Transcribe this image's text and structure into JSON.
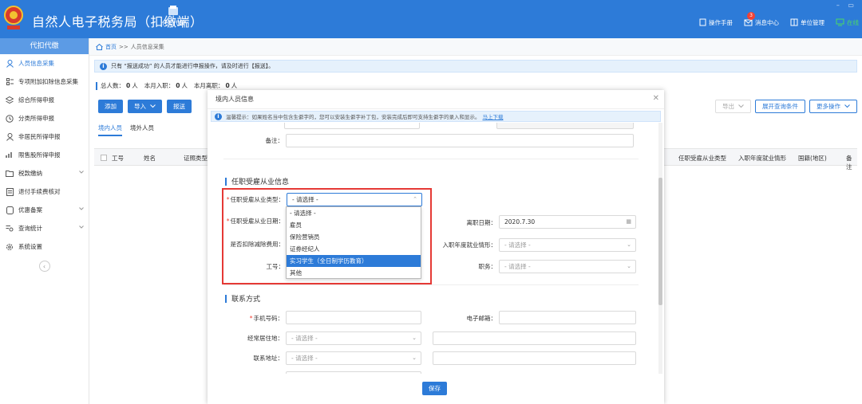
{
  "colors": {
    "primary": "#2d7bd8",
    "highlight": "#e53935",
    "required": "#f04134"
  },
  "header": {
    "app_title": "自然人电子税务局（扣缴端）",
    "withhold_label": "代扣代缴",
    "manual": "操作手册",
    "messages": "消息中心",
    "message_count": "3",
    "unit_mgmt": "单位管理",
    "online": "在线",
    "window_controls": "– ▭"
  },
  "sidebar": {
    "title": "代扣代缴",
    "items": [
      {
        "label": "人员信息采集",
        "icon": "person-icon"
      },
      {
        "label": "专项附加扣除信息采集",
        "icon": "list-icon"
      },
      {
        "label": "综合所得申报",
        "icon": "layers-icon"
      },
      {
        "label": "分类所得申报",
        "icon": "clock-icon"
      },
      {
        "label": "非居民所得申报",
        "icon": "person-icon"
      },
      {
        "label": "限售股所得申报",
        "icon": "bar-chart-icon"
      },
      {
        "label": "税款缴纳",
        "icon": "folder-icon"
      },
      {
        "label": "退付手续费核对",
        "icon": "document-icon"
      },
      {
        "label": "优惠备案",
        "icon": "tag-icon"
      },
      {
        "label": "查询统计",
        "icon": "search-list-icon"
      },
      {
        "label": "系统设置",
        "icon": "gear-icon"
      }
    ]
  },
  "main": {
    "breadcrumb_home": "首页",
    "breadcrumb_sep": ">>",
    "breadcrumb_current": "人员信息采集",
    "info_text": "只有 “报送成功” 的人员才能进行申报操作，请及时进行【报送】。",
    "stats": {
      "total_label": "总人数：",
      "total": "0",
      "unit": "人",
      "joined_label": "本月入职：",
      "joined": "0",
      "left_label": "本月离职：",
      "left": "0"
    },
    "buttons": {
      "add": "添加",
      "import": "导入",
      "submit": "报送",
      "export": "导出",
      "expand_query": "展开查询条件",
      "more_ops": "更多操作"
    },
    "tabs": [
      "境内人员",
      "境外人员"
    ],
    "columns": [
      "工号",
      "姓名",
      "证照类型",
      "任职受雇从业类型",
      "入职年度就业情形",
      "国籍(地区)",
      "备注"
    ]
  },
  "modal": {
    "title": "境内人员信息",
    "tip": "温馨提示：如果姓名当中包含生僻字的，您可以安装生僻字补丁包，安装完成后即可支持生僻字的录入和显示。",
    "tip_link": "马上下载",
    "remark_label": "备注：",
    "section_employment": "任职受雇从业信息",
    "emp_type_label": "任职受雇从业类型：",
    "emp_type_value": "- 请选择 -",
    "emp_date_label": "任职受雇从业日期：",
    "leave_date_label": "离职日期：",
    "leave_date_value": "2020.7.30",
    "deduct_label": "是否扣除减除费用：",
    "first_year_label": "入职年度就业情形：",
    "first_year_value": "- 请选择 -",
    "job_no_label": "工号：",
    "position_label": "职务：",
    "position_value": "- 请选择 -",
    "section_contact": "联系方式",
    "phone_label": "手机号码：",
    "email_label": "电子邮箱：",
    "residence_label": "经常居住地：",
    "residence_value": "- 请选择 -",
    "address_label": "联系地址：",
    "address_value": "- 请选择 -",
    "save": "保存",
    "dropdown_options": [
      "- 请选择 -",
      "雇员",
      "保险营销员",
      "证券经纪人",
      "实习学生（全日制学历教育）",
      "其他"
    ],
    "dropdown_selected_index": 4
  }
}
